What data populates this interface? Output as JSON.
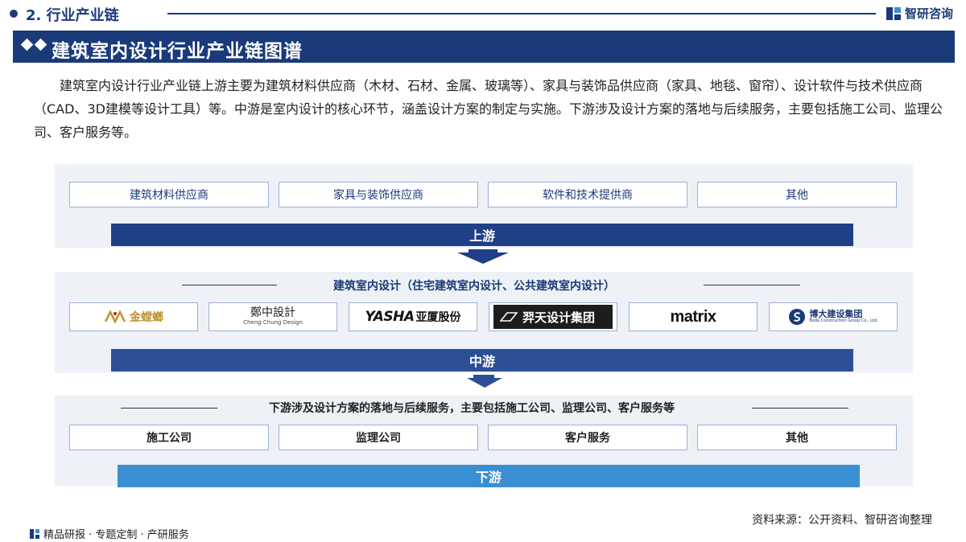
{
  "header": {
    "section_label": "2. 行业产业链",
    "brand_name": "智研咨询",
    "title": "建筑室内设计行业产业链图谱"
  },
  "intro": "建筑室内设计行业产业链上游主要为建筑材料供应商（木材、石材、金属、玻璃等）、家具与装饰品供应商（家具、地毯、窗帘）、设计软件与技术供应商（CAD、3D建模等设计工具）等。中游是室内设计的核心环节，涵盖设计方案的制定与实施。下游涉及设计方案的落地与后续服务，主要包括施工公司、监理公司、客户服务等。",
  "upstream": {
    "items": [
      "建筑材料供应商",
      "家具与装饰供应商",
      "软件和技术提供商",
      "其他"
    ],
    "stage_label": "上游"
  },
  "midstream": {
    "heading": "建筑室内设计（住宅建筑室内设计、公共建筑室内设计）",
    "logos": {
      "jinhuanglang": {
        "mark": "Gold Mantis",
        "name": "金螳螂"
      },
      "zhengzhong": {
        "name": "鄭中設計",
        "sub": "Cheng Chung Design"
      },
      "yasha": {
        "name": "YASHA",
        "cn": "亚厦股份"
      },
      "yitian": {
        "mark": "DESIGN",
        "name": "羿天设计集团"
      },
      "matrix": {
        "name": "matrix"
      },
      "boda": {
        "name": "博大建设集团",
        "sub": "Boda Construction Group Co., Ltd."
      }
    },
    "stage_label": "中游"
  },
  "downstream": {
    "heading": "下游涉及设计方案的落地与后续服务，主要包括施工公司、监理公司、客户服务等",
    "items": [
      "施工公司",
      "监理公司",
      "客户服务",
      "其他"
    ],
    "stage_label": "下游"
  },
  "footer": {
    "source": "资料来源：公开资料、智研咨询整理",
    "tagline": "精品研报 · 专题定制 · 产研服务"
  },
  "colors": {
    "navy": "#1a3a7a",
    "stage_up": "#1f3f86",
    "stage_mid": "#2d4f95",
    "stage_down": "#3a8fd2",
    "band": "#eef1f6"
  }
}
